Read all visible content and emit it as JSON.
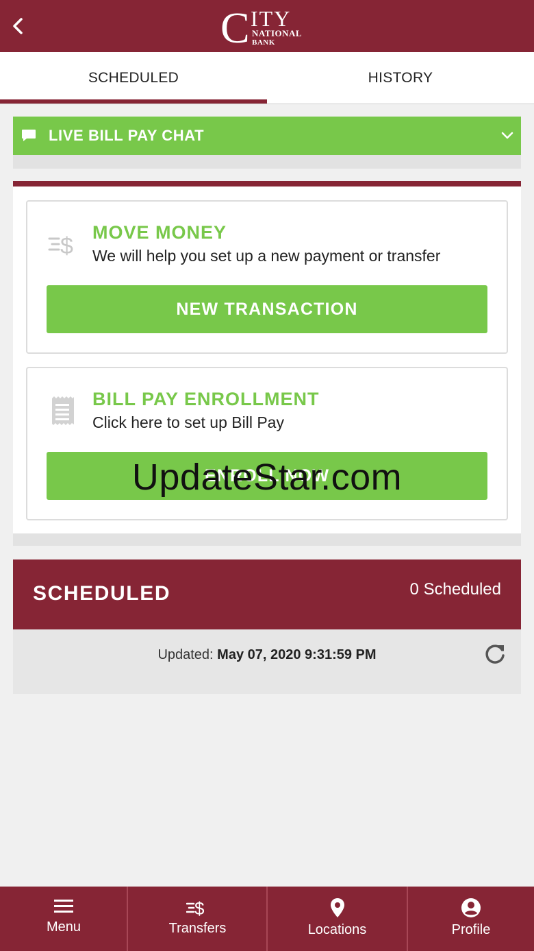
{
  "header": {
    "logo_text": "City National Bank"
  },
  "tabs": [
    {
      "label": "SCHEDULED",
      "active": true
    },
    {
      "label": "HISTORY",
      "active": false
    }
  ],
  "chat": {
    "label": "LIVE BILL PAY CHAT"
  },
  "move_money": {
    "title": "MOVE MONEY",
    "subtitle": "We will help you set up a new payment or transfer",
    "button": "NEW TRANSACTION"
  },
  "enrollment": {
    "title": "BILL PAY ENROLLMENT",
    "subtitle": "Click here to set up Bill Pay",
    "button": "ENROLL NOW"
  },
  "watermark": "UpdateStar.com",
  "scheduled": {
    "title": "SCHEDULED",
    "count": "0 Scheduled",
    "updated_label": "Updated:",
    "updated_value": "May 07, 2020 9:31:59 PM"
  },
  "bottom_nav": [
    {
      "label": "Menu",
      "icon": "menu-icon"
    },
    {
      "label": "Transfers",
      "icon": "transfers-icon"
    },
    {
      "label": "Locations",
      "icon": "location-pin-icon"
    },
    {
      "label": "Profile",
      "icon": "profile-icon"
    }
  ],
  "colors": {
    "brand": "#862535",
    "accent": "#78c84a",
    "background": "#f0f0f0"
  }
}
